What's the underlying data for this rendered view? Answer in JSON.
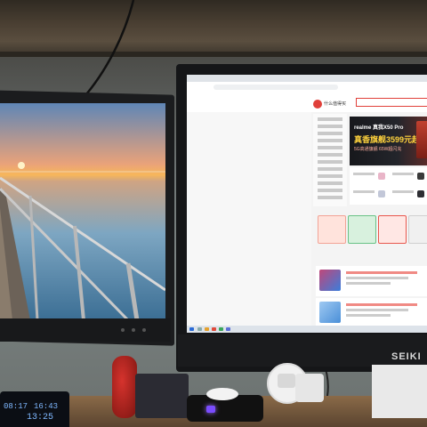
{
  "monitor_right": {
    "brand": "SEIKI"
  },
  "website": {
    "logo_text": "什么值得买",
    "banner_title": "realme 真我X50 Pro",
    "banner_price": "真香旗舰3599元起",
    "banner_sub": "5G高通旗舰 65W超闪充"
  },
  "desk_clock": {
    "time": "08:17",
    "value": "16:43",
    "big": "13:25"
  },
  "colors": {
    "accent": "#e0403a",
    "screen_bg": "#f4f4f4",
    "clock_digits": "#7fb8ff"
  },
  "icons": [
    "cable-icon",
    "phone-icon"
  ]
}
